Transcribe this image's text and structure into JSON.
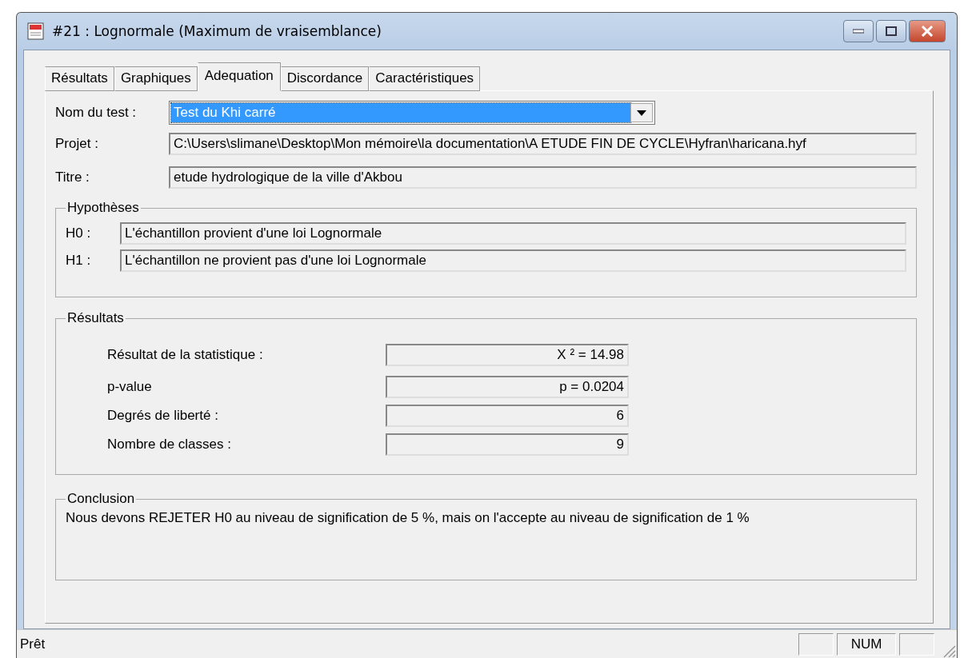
{
  "window": {
    "title": "#21 : Lognormale (Maximum de vraisemblance)"
  },
  "tabs": [
    {
      "label": "Résultats",
      "selected": false
    },
    {
      "label": "Graphiques",
      "selected": false
    },
    {
      "label": "Adequation",
      "selected": true
    },
    {
      "label": "Discordance",
      "selected": false
    },
    {
      "label": "Caractéristiques",
      "selected": false
    }
  ],
  "test": {
    "label": "Nom du test :",
    "value": "Test du Khi carré"
  },
  "fields": [
    {
      "label": "Projet :",
      "value": "C:\\Users\\slimane\\Desktop\\Mon mémoire\\la documentation\\A ETUDE FIN DE CYCLE\\Hyfran\\haricana.hyf"
    },
    {
      "label": "Titre :",
      "value": "etude hydrologique de la ville d'Akbou"
    }
  ],
  "hypotheses": {
    "title": "Hypothèses",
    "items": [
      {
        "label": "H0 :",
        "value": "L'échantillon provient d'une loi Lognormale"
      },
      {
        "label": "H1 :",
        "value": "L'échantillon ne provient pas d'une loi Lognormale"
      }
    ]
  },
  "results": {
    "title": "Résultats",
    "items": [
      {
        "label": "Résultat de la statistique :",
        "value": "X ² = 14.98"
      },
      {
        "label": "p-value",
        "value": "p = 0.0204"
      },
      {
        "label": "Degrés de liberté :",
        "value": "6"
      },
      {
        "label": "Nombre de classes :",
        "value": "9"
      }
    ]
  },
  "conclusion": {
    "title": "Conclusion",
    "text": "Nous devons REJETER H0 au niveau de signification de 5 %, mais on l'accepte au niveau de signification de 1 %"
  },
  "status_bar": {
    "text": "Prêt",
    "indicators": [
      "NUM"
    ]
  }
}
